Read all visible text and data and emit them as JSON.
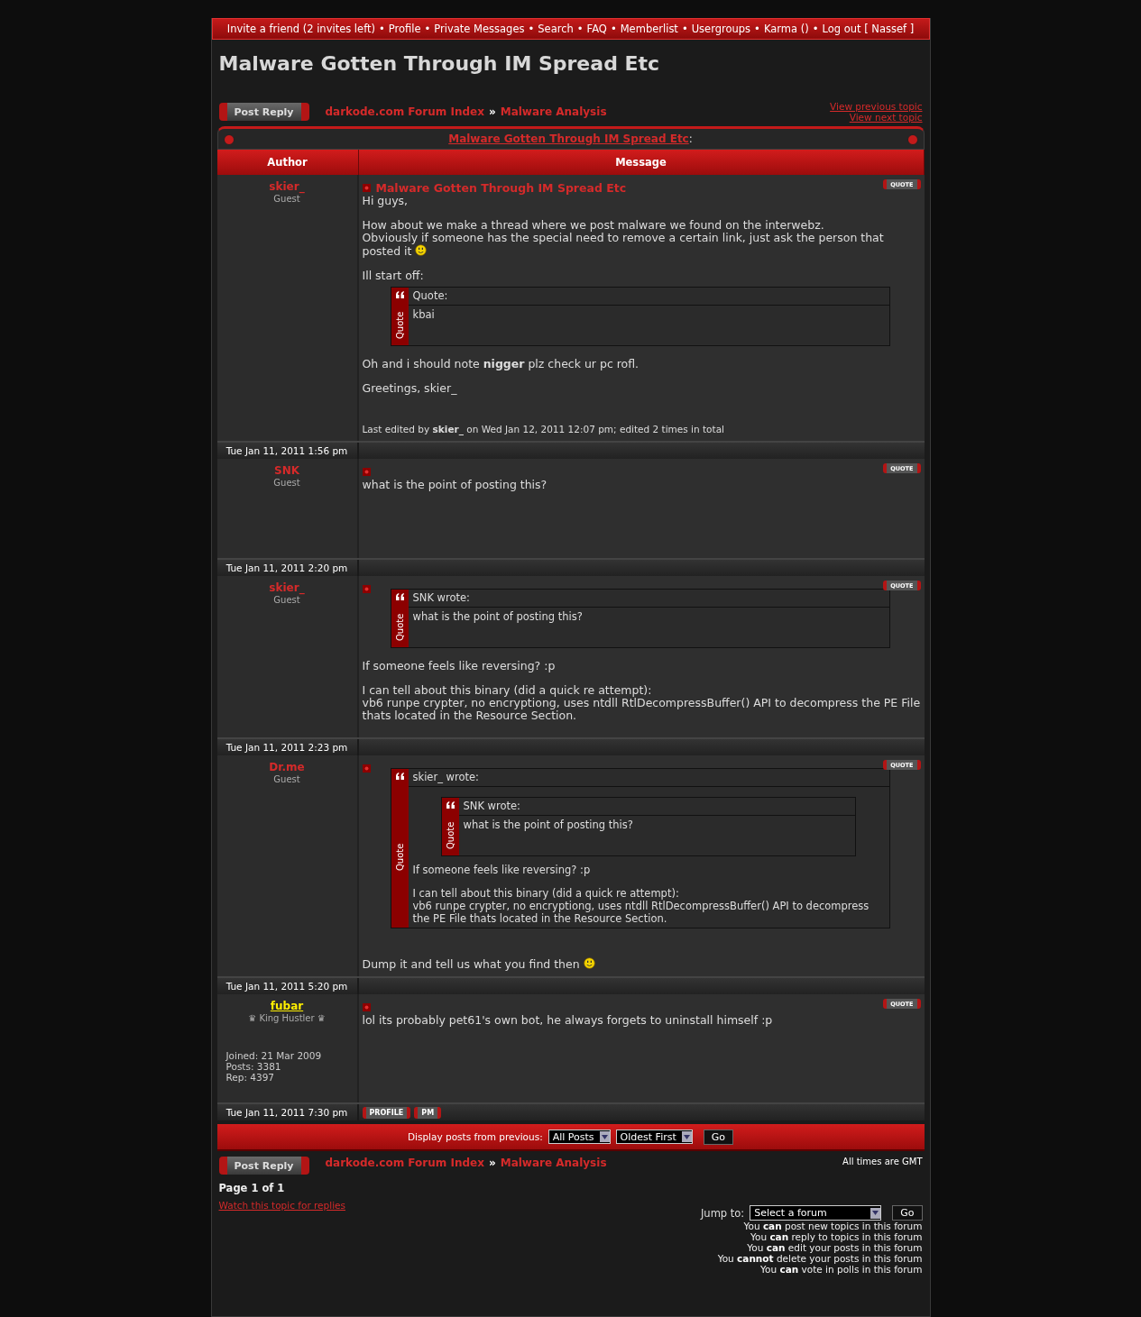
{
  "nav": {
    "separator": "•",
    "items": [
      "Invite a friend (2 invites left)",
      "Profile",
      "Private Messages",
      "Search",
      "FAQ",
      "Memberlist",
      "Usergroups",
      "Karma ()",
      "Log out [ Nassef ]"
    ]
  },
  "topic_title": "Malware Gotten Through IM Spread Etc",
  "top_bar": {
    "post_reply": "Post Reply",
    "breadcrumb": [
      "darkode.com Forum Index",
      "Malware Analysis"
    ],
    "breadcrumb_separator": "»",
    "view_previous": "View previous topic",
    "view_next": "View next topic"
  },
  "table": {
    "title_link": "Malware Gotten Through IM Spread Etc",
    "title_suffix": ":",
    "columns": [
      "Author",
      "Message"
    ]
  },
  "posts": [
    {
      "author": "skier_",
      "member": false,
      "rank": "Guest",
      "time": "Tue Jan 11, 2011 1:56 pm",
      "subject": "Malware Gotten Through IM Spread Etc",
      "quote_button": "QUOTE",
      "body": [
        {
          "kind": "text",
          "text": "Hi guys,"
        },
        {
          "kind": "text",
          "text": "How about we make a thread where we post malware we found on the interwebz.\nObviously if someone has the special need to remove a certain link, just ask the person that posted it",
          "smiley": true
        },
        {
          "kind": "text",
          "text": "Ill start off:"
        },
        {
          "kind": "quote",
          "header": "Quote:",
          "label": "Quote",
          "blocks": [
            {
              "kind": "text",
              "text": "kbai"
            }
          ]
        },
        {
          "kind": "text",
          "text": "Oh and i should note **nigger** plz check ur pc rofl."
        },
        {
          "kind": "text",
          "text": "Greetings, skier_"
        }
      ],
      "edit_note": "Last edited by **skier_** on Wed Jan 12, 2011 12:07 pm; edited 2 times in total"
    },
    {
      "author": "SNK",
      "member": false,
      "rank": "Guest",
      "time": "Tue Jan 11, 2011 2:20 pm",
      "quote_button": "QUOTE",
      "body": [
        {
          "kind": "text",
          "text": "what is the point of posting this?"
        }
      ]
    },
    {
      "author": "skier_",
      "member": false,
      "rank": "Guest",
      "time": "Tue Jan 11, 2011 2:23 pm",
      "quote_button": "QUOTE",
      "body": [
        {
          "kind": "quote",
          "header": "SNK wrote:",
          "label": "Quote",
          "blocks": [
            {
              "kind": "text",
              "text": "what is the point of posting this?"
            }
          ]
        },
        {
          "kind": "text",
          "text": "If someone feels like reversing? :p"
        },
        {
          "kind": "text",
          "text": "I can tell about this binary (did a quick re attempt):\nvb6 runpe crypter, no encryptiong, uses ntdll RtlDecompressBuffer() API to decompress the PE File thats located in the Resource Section."
        }
      ]
    },
    {
      "author": "Dr.me",
      "member": false,
      "rank": "Guest",
      "time": "Tue Jan 11, 2011 5:20 pm",
      "quote_button": "QUOTE",
      "body": [
        {
          "kind": "quote",
          "header": "skier_ wrote:",
          "label": "Quote",
          "blocks": [
            {
              "kind": "quote",
              "header": "SNK wrote:",
              "label": "Quote",
              "blocks": [
                {
                  "kind": "text",
                  "text": "what is the point of posting this?"
                }
              ]
            },
            {
              "kind": "text",
              "text": "If someone feels like reversing? :p"
            },
            {
              "kind": "text",
              "text": "I can tell about this binary (did a quick re attempt):\nvb6 runpe crypter, no encryptiong, uses ntdll RtlDecompressBuffer() API to decompress the PE File thats located in the Resource Section."
            }
          ]
        },
        {
          "kind": "text",
          "text": "Dump it and tell us what you find then",
          "smiley": true
        }
      ]
    },
    {
      "author": "fubar",
      "member": true,
      "rank": "♛ King Hustler ♛",
      "stats": [
        "Joined: 21 Mar 2009",
        "Posts: 3381",
        "Rep: 4397"
      ],
      "time": "Tue Jan 11, 2011 7:30 pm",
      "quote_button": "QUOTE",
      "footer_buttons": [
        "PROFILE",
        "PM"
      ],
      "body": [
        {
          "kind": "text",
          "text": "lol its probably pet61's own bot, he always forgets to uninstall himself :p"
        }
      ]
    }
  ],
  "display_bar": {
    "label": "Display posts from previous:",
    "selects": [
      "All Posts",
      "Oldest First"
    ],
    "go": "Go"
  },
  "bottom": {
    "post_reply": "Post Reply",
    "breadcrumb": [
      "darkode.com Forum Index",
      "Malware Analysis"
    ],
    "breadcrumb_separator": "»",
    "timezone": "All times are GMT",
    "page": "Page 1 of 1",
    "watch": "Watch this topic for replies",
    "jump_label": "Jump to:",
    "jump_select": "Select a forum",
    "jump_go": "Go",
    "permissions": [
      "You **can** post new topics in this forum",
      "You **can** reply to topics in this forum",
      "You **can** edit your posts in this forum",
      "You **cannot** delete your posts in this forum",
      "You **can** vote in polls in this forum"
    ]
  }
}
